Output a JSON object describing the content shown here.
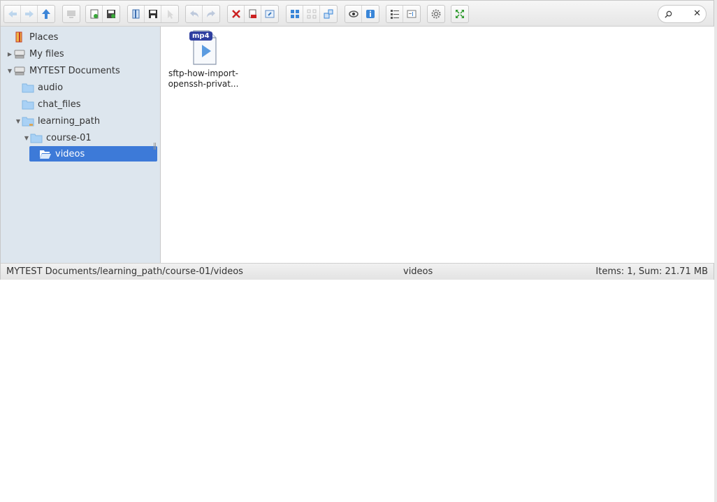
{
  "toolbar": {
    "groups": [
      [
        "back-icon",
        "forward-icon",
        "up-icon"
      ],
      [
        "home-icon"
      ],
      [
        "reload-icon",
        "save-icon"
      ],
      [
        "open-icon",
        "save-alt-icon",
        "select-icon"
      ],
      [
        "undo-icon",
        "redo-icon"
      ],
      [
        "delete-icon",
        "copy-icon",
        "info-icon"
      ],
      [
        "view-large-icon",
        "view-small-icon",
        "view-tiles-icon"
      ],
      [
        "preview-icon",
        "details-icon"
      ],
      [
        "list-icon",
        "rename-icon"
      ],
      [
        "settings-icon"
      ],
      [
        "fullscreen-icon"
      ]
    ],
    "search_placeholder": ""
  },
  "tree": {
    "places": "Places",
    "my_files": "My files",
    "mytest_documents": "MYTEST Documents",
    "audio": "audio",
    "chat_files": "chat_files",
    "learning_path": "learning_path",
    "course_01": "course-01",
    "videos": "videos"
  },
  "files": [
    {
      "badge": "mp4",
      "name_line1": "sftp-how-import-",
      "name_line2": "openssh-privat..."
    }
  ],
  "status": {
    "path": "MYTEST Documents/learning_path/course-01/videos",
    "cwd": "videos",
    "summary": "Items: 1, Sum: 21.71 MB"
  },
  "colors": {
    "sidebar_bg": "#dde6ee",
    "selected": "#3d7ad8",
    "folder": "#9ecaf0",
    "badge": "#2f3fa0"
  }
}
